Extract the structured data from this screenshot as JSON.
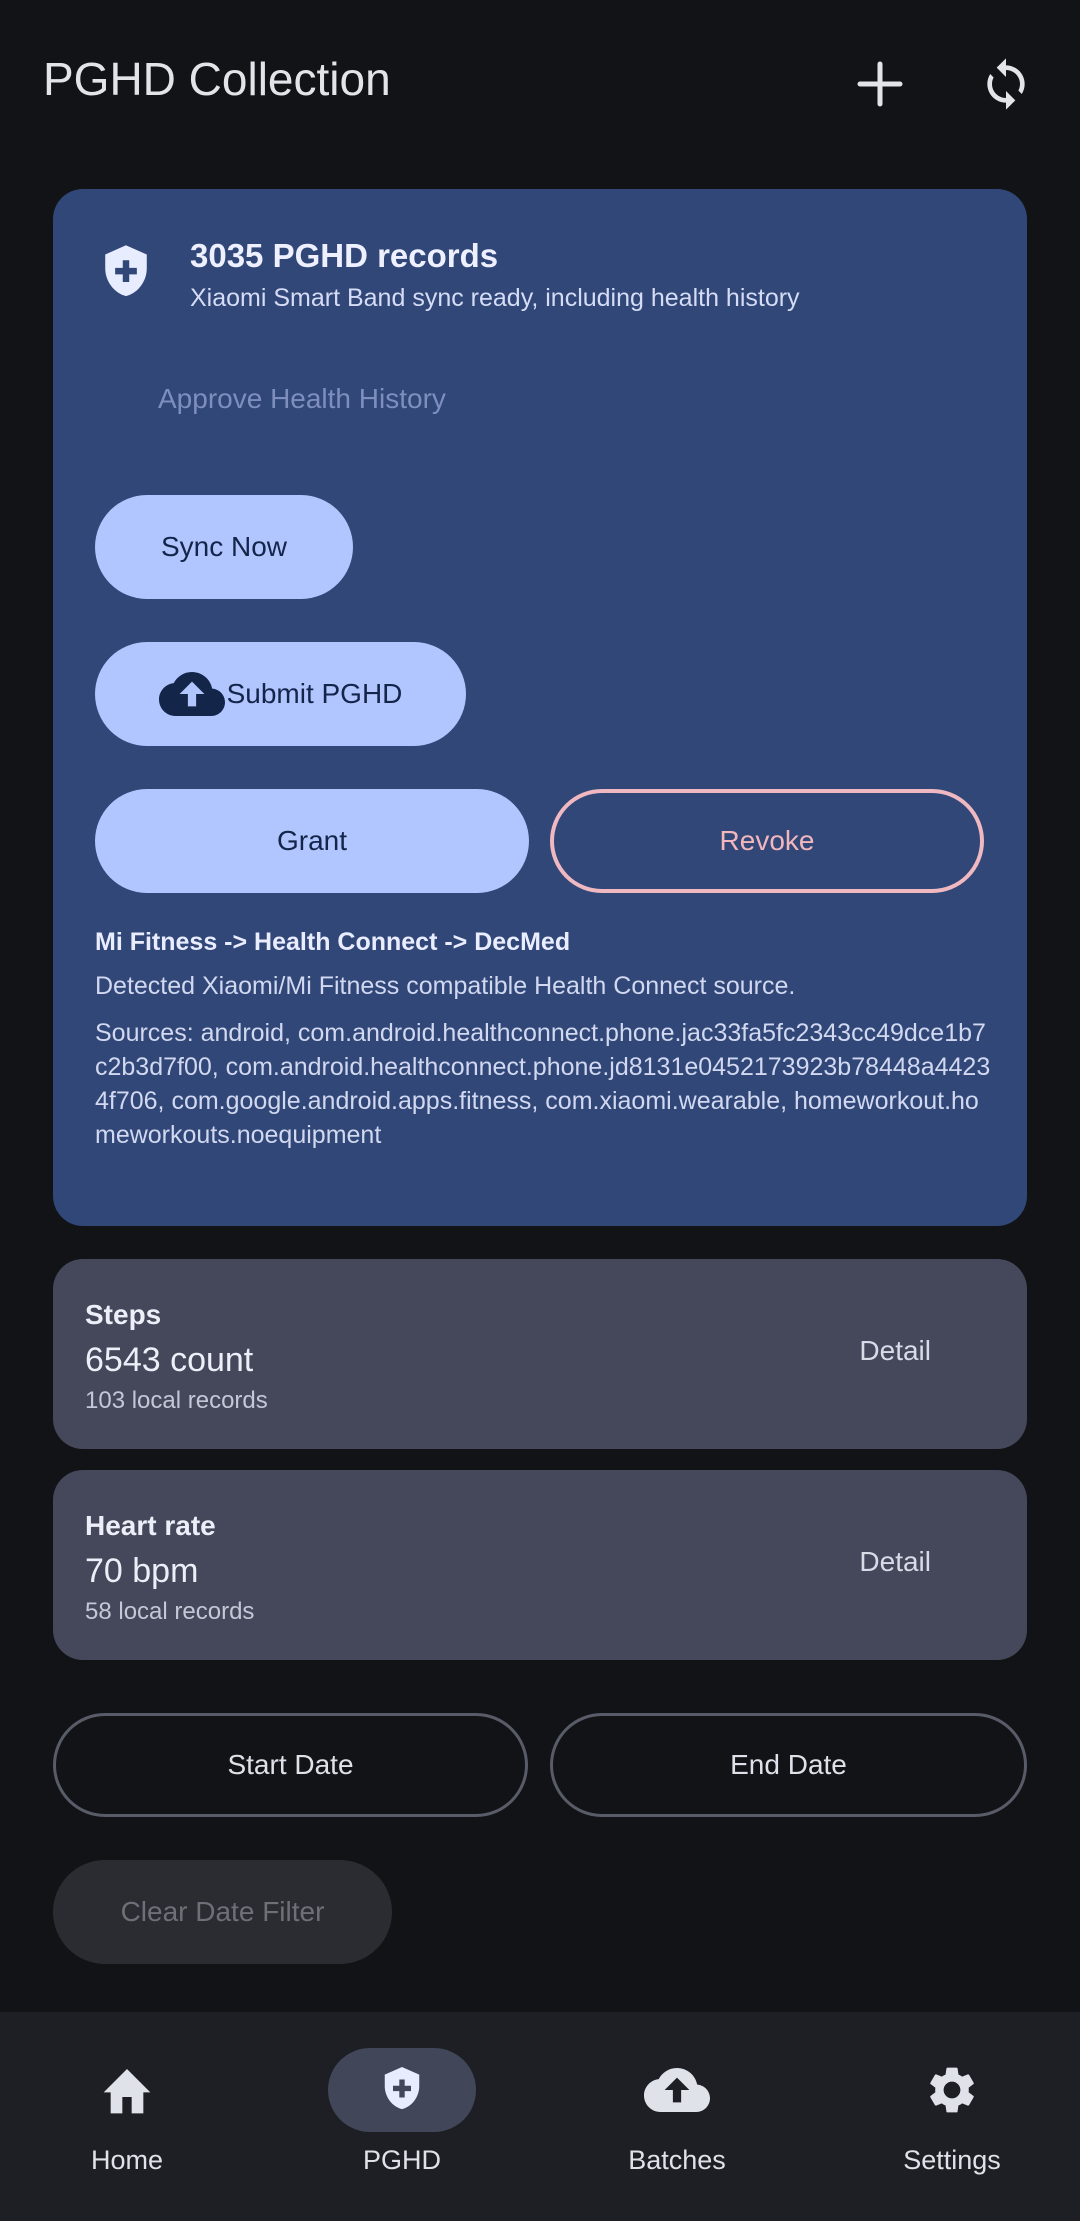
{
  "header": {
    "title": "PGHD Collection"
  },
  "summary": {
    "title": "3035 PGHD records",
    "subtitle": "Xiaomi Smart Band sync ready, including health history",
    "approve_label": "Approve Health History",
    "sync_label": "Sync Now",
    "submit_label": "Submit PGHD",
    "grant_label": "Grant",
    "revoke_label": "Revoke",
    "pipeline": "Mi Fitness -> Health Connect -> DecMed",
    "detected": "Detected Xiaomi/Mi Fitness compatible Health Connect source.",
    "sources": "Sources: android, com.android.healthconnect.phone.jac33fa5fc2343cc49dce1b7c2b3d7f00, com.android.healthconnect.phone.jd8131e0452173923b78448a44234f706, com.google.android.apps.fitness, com.xiaomi.wearable, homeworkout.homeworkouts.noequipment"
  },
  "metrics": [
    {
      "label": "Steps",
      "value": "6543 count",
      "records": "103 local records",
      "action": "Detail"
    },
    {
      "label": "Heart rate",
      "value": "70 bpm",
      "records": "58 local records",
      "action": "Detail"
    }
  ],
  "filters": {
    "start_label": "Start Date",
    "end_label": "End Date",
    "clear_label": "Clear Date Filter"
  },
  "nav": {
    "items": [
      {
        "label": "Home",
        "icon": "home-icon"
      },
      {
        "label": "PGHD",
        "icon": "shield-plus-icon",
        "active": true
      },
      {
        "label": "Batches",
        "icon": "cloud-upload-icon"
      },
      {
        "label": "Settings",
        "icon": "gear-icon"
      }
    ]
  },
  "colors": {
    "background": "#121316",
    "card_primary": "#304778",
    "button_filled": "#b1c5ff",
    "revoke_accent": "#f0b8c0",
    "metric_card": "#44485a",
    "nav_bar": "#1d1f24"
  }
}
